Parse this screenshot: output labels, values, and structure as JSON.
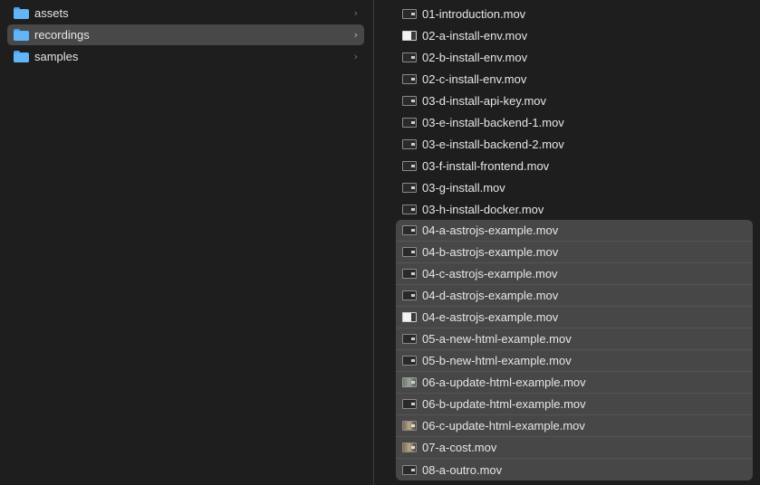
{
  "left_column": {
    "folders": [
      {
        "label": "assets",
        "selected": false
      },
      {
        "label": "recordings",
        "selected": true
      },
      {
        "label": "samples",
        "selected": false
      }
    ],
    "chevron_glyph": "›"
  },
  "right_column": {
    "files": [
      {
        "label": "01-introduction.mov",
        "thumb": "dark",
        "selected": false
      },
      {
        "label": "02-a-install-env.mov",
        "thumb": "light",
        "selected": false
      },
      {
        "label": "02-b-install-env.mov",
        "thumb": "dark",
        "selected": false
      },
      {
        "label": "02-c-install-env.mov",
        "thumb": "dark",
        "selected": false
      },
      {
        "label": "03-d-install-api-key.mov",
        "thumb": "dark",
        "selected": false
      },
      {
        "label": "03-e-install-backend-1.mov",
        "thumb": "dark",
        "selected": false
      },
      {
        "label": "03-e-install-backend-2.mov",
        "thumb": "dark",
        "selected": false
      },
      {
        "label": "03-f-install-frontend.mov",
        "thumb": "dark",
        "selected": false
      },
      {
        "label": "03-g-install.mov",
        "thumb": "dark",
        "selected": false
      },
      {
        "label": "03-h-install-docker.mov",
        "thumb": "dark",
        "selected": false
      },
      {
        "label": "04-a-astrojs-example.mov",
        "thumb": "dark",
        "selected": true
      },
      {
        "label": "04-b-astrojs-example.mov",
        "thumb": "dark",
        "selected": true
      },
      {
        "label": "04-c-astrojs-example.mov",
        "thumb": "dark",
        "selected": true
      },
      {
        "label": "04-d-astrojs-example.mov",
        "thumb": "dark",
        "selected": true
      },
      {
        "label": "04-e-astrojs-example.mov",
        "thumb": "light",
        "selected": true
      },
      {
        "label": "05-a-new-html-example.mov",
        "thumb": "dark",
        "selected": true
      },
      {
        "label": "05-b-new-html-example.mov",
        "thumb": "dark",
        "selected": true
      },
      {
        "label": "06-a-update-html-example.mov",
        "thumb": "photo",
        "selected": true
      },
      {
        "label": "06-b-update-html-example.mov",
        "thumb": "dark",
        "selected": true
      },
      {
        "label": "06-c-update-html-example.mov",
        "thumb": "warm",
        "selected": true
      },
      {
        "label": "07-a-cost.mov",
        "thumb": "warm",
        "selected": true
      },
      {
        "label": "08-a-outro.mov",
        "thumb": "dark",
        "selected": true
      }
    ]
  },
  "colors": {
    "background": "#1e1e1e",
    "selected_row": "#484848",
    "selection_block": "#474747",
    "folder_blue": "#5fb2f5",
    "text": "#e6e6e6"
  },
  "icons": {
    "folder": "folder-icon",
    "chevron": "chevron-right-icon",
    "video_thumbnail": "video-thumbnail-icon"
  }
}
